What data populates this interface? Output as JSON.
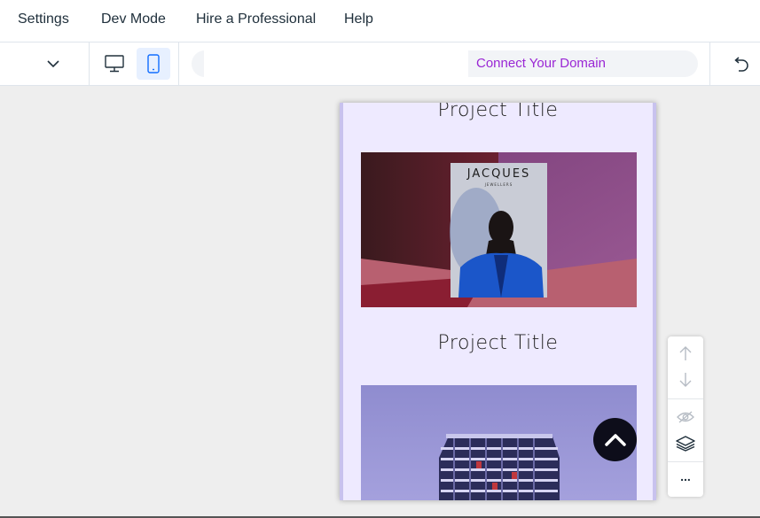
{
  "menubar": {
    "items": [
      "Settings",
      "Dev Mode",
      "Hire a Professional",
      "Help"
    ]
  },
  "toolbar": {
    "connect_domain": "Connect Your Domain",
    "icons": [
      "chevron-down-icon",
      "desktop-icon",
      "mobile-icon",
      "undo-icon"
    ]
  },
  "canvas": {
    "projects": [
      {
        "title": "Project Title",
        "image_text": "JACQUES",
        "image_subtext": "JEWELLERS"
      },
      {
        "title": "Project Title"
      }
    ]
  },
  "side_panel": {
    "icons": [
      "arrow-up-icon",
      "arrow-down-icon",
      "eye-hidden-icon",
      "layers-icon",
      "more-icon"
    ],
    "more_label": "..."
  },
  "colors": {
    "accent": "#9a27d5",
    "canvas_bg": "#eeeaff",
    "active_blue": "#116dff"
  }
}
